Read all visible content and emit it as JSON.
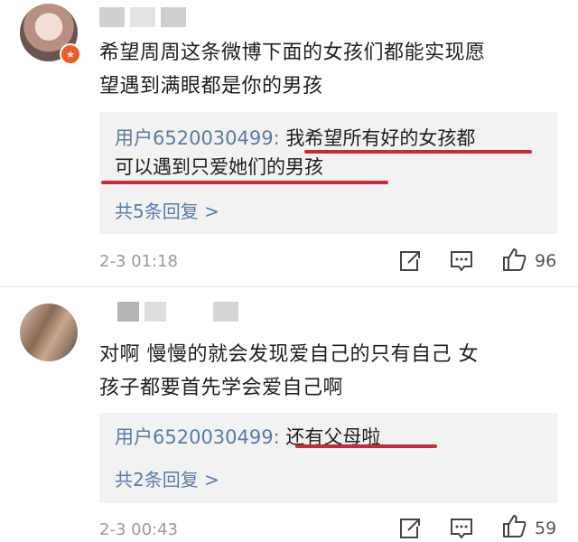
{
  "comments": [
    {
      "text_line1": "希望周周这条微博下面的女孩们都能实现愿",
      "text_line2": "望遇到满眼都是你的男孩",
      "reply": {
        "user": "用户6520030499:",
        "line1": " 我希望所有好的女孩都",
        "line2": "可以遇到只爱她们的男孩"
      },
      "more_replies": "共5条回复 >",
      "timestamp": "2-3 01:18",
      "likes": "96"
    },
    {
      "text_line1": "对啊 慢慢的就会发现爱自己的只有自己 女",
      "text_line2": "孩子都要首先学会爱自己啊",
      "reply": {
        "user": "用户6520030499:",
        "line1": " 还有父母啦"
      },
      "more_replies": "共2条回复 >",
      "timestamp": "2-3 00:43",
      "likes": "59"
    }
  ],
  "icons": [
    "share-icon",
    "comment-icon",
    "like-icon"
  ],
  "colors": {
    "link": "#5b7ba7",
    "underline": "#d0263b",
    "badge": "#f25a29"
  }
}
